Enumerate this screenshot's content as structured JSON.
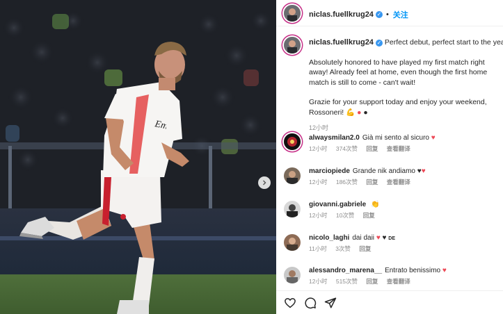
{
  "header": {
    "username": "niclas.fuellkrug24",
    "follow_label": "关注"
  },
  "post": {
    "username": "niclas.fuellkrug24",
    "headline": "Perfect debut, perfect start to the year",
    "body": "Absolutely honored to have played my first match right away! Already feel at home, even though the first home match is still to come - can't wait!",
    "thanks": "Grazie for your support today and enjoy your weekend, Rossoneri!",
    "time": "12小时"
  },
  "comments": [
    {
      "username": "alwaysmilan2.0",
      "text": "Già mi sento al sicuro",
      "time": "12小时",
      "likes": "374次赞",
      "reply": "回复",
      "translate": "查看翻译"
    },
    {
      "username": "marciopiede",
      "text": "Grande nik andiamo",
      "time": "12小时",
      "likes": "186次赞",
      "reply": "回复",
      "translate": "查看翻译"
    },
    {
      "username": "giovanni.gabriele",
      "text": "",
      "time": "12小时",
      "likes": "10次赞",
      "reply": "回复",
      "translate": ""
    },
    {
      "username": "nicolo_laghi",
      "text": "dai daii",
      "time": "11小时",
      "likes": "3次赞",
      "reply": "回复",
      "translate": ""
    },
    {
      "username": "alessandro_marena__",
      "text": "Entrato benissimo",
      "time": "12小时",
      "likes": "515次赞",
      "reply": "回复",
      "translate": "查看翻译"
    }
  ],
  "jersey_sponsor": "Emirates",
  "colors": {
    "accent": "#0095f6",
    "verified": "#3897f0",
    "heart": "#ed4956",
    "story_ring": "#c62f87"
  }
}
